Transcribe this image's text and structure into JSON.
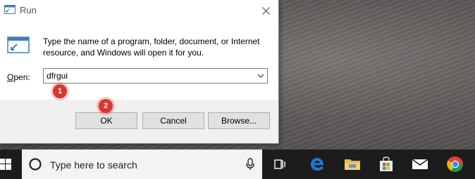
{
  "dialog": {
    "title": "Run",
    "description": "Type the name of a program, folder, document, or Internet resource, and Windows will open it for you.",
    "open_label_underlined": "O",
    "open_label_rest": "pen:",
    "input_value": "dfrgui",
    "buttons": {
      "ok": "OK",
      "cancel": "Cancel",
      "browse": "Browse..."
    }
  },
  "annotations": {
    "badge1": "1",
    "badge2": "2"
  },
  "taskbar": {
    "search_placeholder": "Type here to search",
    "icons": [
      "windows-start-icon",
      "task-view-icon",
      "edge-icon",
      "file-explorer-icon",
      "store-icon",
      "mail-icon",
      "chrome-icon"
    ]
  },
  "colors": {
    "badge": "#d9362e",
    "taskbar": "#1c1c1c",
    "edge_blue": "#1e7ad6"
  }
}
